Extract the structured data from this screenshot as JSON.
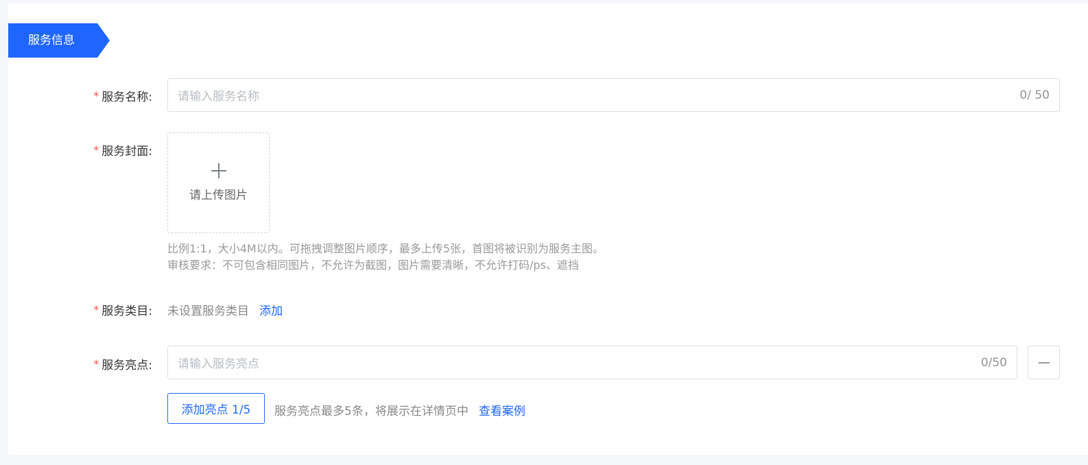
{
  "section": {
    "title": "服务信息"
  },
  "fields": {
    "name": {
      "label": "服务名称:",
      "placeholder": "请输入服务名称",
      "counter": "0/ 50"
    },
    "cover": {
      "label": "服务封面:",
      "upload_text": "请上传图片",
      "hint_line1": "比例1:1，大小4M以内。可拖拽调整图片顺序，最多上传5张，首图将被识别为服务主图。",
      "hint_line2": "审核要求：不可包含相同图片，不允许为截图，图片需要清晰，不允许打码/ps、遮挡"
    },
    "category": {
      "label": "服务类目:",
      "value": "未设置服务类目",
      "add_link": "添加"
    },
    "highlight": {
      "label": "服务亮点:",
      "placeholder": "请输入服务亮点",
      "counter": "0/50",
      "add_button": "添加亮点 1/5",
      "hint": "服务亮点最多5条，将展示在详情页中",
      "case_link": "查看案例"
    }
  },
  "colors": {
    "accent": "#1f66ff",
    "required": "#f5534a"
  },
  "icons": {
    "upload": "plus-icon",
    "remove": "minus-icon"
  }
}
